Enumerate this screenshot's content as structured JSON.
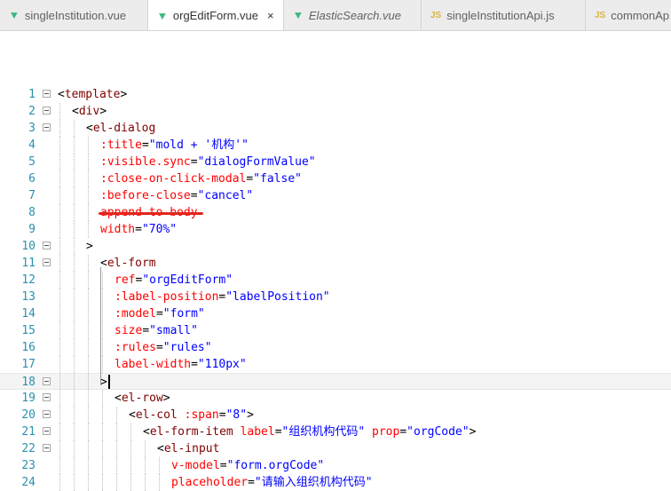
{
  "tabs": [
    {
      "label": "singleInstitution.vue",
      "icon": "vue-icon",
      "type": "vue",
      "active": false,
      "italic": false
    },
    {
      "label": "orgEditForm.vue",
      "icon": "vue-icon",
      "type": "vue",
      "active": true,
      "italic": false
    },
    {
      "label": "ElasticSearch.vue",
      "icon": "vue-icon",
      "type": "vue",
      "active": false,
      "italic": true
    },
    {
      "label": "singleInstitutionApi.js",
      "icon": "js-icon",
      "type": "js",
      "active": false,
      "italic": false
    },
    {
      "label": "commonAp",
      "icon": "js-icon",
      "type": "js",
      "active": false,
      "italic": false
    }
  ],
  "close_glyph": "×",
  "editor": {
    "current_line": 18,
    "strikethrough_line": 8,
    "lines": [
      {
        "n": "1",
        "indent": 0,
        "fold": true,
        "tokens": [
          [
            "t-punc",
            "<"
          ],
          [
            "t-tag",
            "template"
          ],
          [
            "t-punc",
            ">"
          ]
        ]
      },
      {
        "n": "2",
        "indent": 1,
        "fold": true,
        "tokens": [
          [
            "t-punc",
            "<"
          ],
          [
            "t-tag",
            "div"
          ],
          [
            "t-punc",
            ">"
          ]
        ]
      },
      {
        "n": "3",
        "indent": 2,
        "fold": true,
        "tokens": [
          [
            "t-punc",
            "<"
          ],
          [
            "t-tag",
            "el-dialog"
          ]
        ]
      },
      {
        "n": "4",
        "indent": 3,
        "fold": false,
        "tokens": [
          [
            "t-attr",
            ":title"
          ],
          [
            "t-punc",
            "="
          ],
          [
            "t-str",
            "\"mold + '机构'\""
          ]
        ]
      },
      {
        "n": "5",
        "indent": 3,
        "fold": false,
        "tokens": [
          [
            "t-attr",
            ":visible.sync"
          ],
          [
            "t-punc",
            "="
          ],
          [
            "t-str",
            "\"dialogFormValue\""
          ]
        ]
      },
      {
        "n": "6",
        "indent": 3,
        "fold": false,
        "tokens": [
          [
            "t-attr",
            ":close-on-click-modal"
          ],
          [
            "t-punc",
            "="
          ],
          [
            "t-str",
            "\"false\""
          ]
        ]
      },
      {
        "n": "7",
        "indent": 3,
        "fold": false,
        "tokens": [
          [
            "t-attr",
            ":before-close"
          ],
          [
            "t-punc",
            "="
          ],
          [
            "t-str",
            "\"cancel\""
          ]
        ]
      },
      {
        "n": "8",
        "indent": 3,
        "fold": false,
        "tokens": [
          [
            "t-attr",
            "append-to-body"
          ]
        ]
      },
      {
        "n": "9",
        "indent": 3,
        "fold": false,
        "tokens": [
          [
            "t-attr",
            "width"
          ],
          [
            "t-punc",
            "="
          ],
          [
            "t-str",
            "\"70%\""
          ]
        ]
      },
      {
        "n": "10",
        "indent": 2,
        "fold": true,
        "tokens": [
          [
            "t-punc",
            ">"
          ]
        ]
      },
      {
        "n": "11",
        "indent": 3,
        "fold": true,
        "tokens": [
          [
            "t-punc",
            "<"
          ],
          [
            "t-tag",
            "el-form"
          ]
        ]
      },
      {
        "n": "12",
        "indent": 4,
        "fold": false,
        "tokens": [
          [
            "t-attr",
            "ref"
          ],
          [
            "t-punc",
            "="
          ],
          [
            "t-str",
            "\"orgEditForm\""
          ]
        ]
      },
      {
        "n": "13",
        "indent": 4,
        "fold": false,
        "tokens": [
          [
            "t-attr",
            ":label-position"
          ],
          [
            "t-punc",
            "="
          ],
          [
            "t-str",
            "\"labelPosition\""
          ]
        ]
      },
      {
        "n": "14",
        "indent": 4,
        "fold": false,
        "tokens": [
          [
            "t-attr",
            ":model"
          ],
          [
            "t-punc",
            "="
          ],
          [
            "t-str",
            "\"form\""
          ]
        ]
      },
      {
        "n": "15",
        "indent": 4,
        "fold": false,
        "tokens": [
          [
            "t-attr",
            "size"
          ],
          [
            "t-punc",
            "="
          ],
          [
            "t-str",
            "\"small\""
          ]
        ]
      },
      {
        "n": "16",
        "indent": 4,
        "fold": false,
        "tokens": [
          [
            "t-attr",
            ":rules"
          ],
          [
            "t-punc",
            "="
          ],
          [
            "t-str",
            "\"rules\""
          ]
        ]
      },
      {
        "n": "17",
        "indent": 4,
        "fold": false,
        "tokens": [
          [
            "t-attr",
            "label-width"
          ],
          [
            "t-punc",
            "="
          ],
          [
            "t-str",
            "\"110px\""
          ]
        ]
      },
      {
        "n": "18",
        "indent": 3,
        "fold": true,
        "tokens": [
          [
            "t-punc",
            ">"
          ]
        ]
      },
      {
        "n": "19",
        "indent": 4,
        "fold": true,
        "tokens": [
          [
            "t-punc",
            "<"
          ],
          [
            "t-tag",
            "el-row"
          ],
          [
            "t-punc",
            ">"
          ]
        ]
      },
      {
        "n": "20",
        "indent": 5,
        "fold": true,
        "tokens": [
          [
            "t-punc",
            "<"
          ],
          [
            "t-tag",
            "el-col"
          ],
          [
            "t-punc",
            " "
          ],
          [
            "t-attr",
            ":span"
          ],
          [
            "t-punc",
            "="
          ],
          [
            "t-str",
            "\"8\""
          ],
          [
            "t-punc",
            ">"
          ]
        ]
      },
      {
        "n": "21",
        "indent": 6,
        "fold": true,
        "tokens": [
          [
            "t-punc",
            "<"
          ],
          [
            "t-tag",
            "el-form-item"
          ],
          [
            "t-punc",
            " "
          ],
          [
            "t-attr",
            "label"
          ],
          [
            "t-punc",
            "="
          ],
          [
            "t-str",
            "\"组织机构代码\""
          ],
          [
            "t-punc",
            " "
          ],
          [
            "t-attr",
            "prop"
          ],
          [
            "t-punc",
            "="
          ],
          [
            "t-str",
            "\"orgCode\""
          ],
          [
            "t-punc",
            ">"
          ]
        ]
      },
      {
        "n": "22",
        "indent": 7,
        "fold": true,
        "tokens": [
          [
            "t-punc",
            "<"
          ],
          [
            "t-tag",
            "el-input"
          ]
        ]
      },
      {
        "n": "23",
        "indent": 8,
        "fold": false,
        "tokens": [
          [
            "t-attr",
            "v-model"
          ],
          [
            "t-punc",
            "="
          ],
          [
            "t-str",
            "\"form.orgCode\""
          ]
        ]
      },
      {
        "n": "24",
        "indent": 8,
        "fold": false,
        "tokens": [
          [
            "t-attr",
            "placeholder"
          ],
          [
            "t-punc",
            "="
          ],
          [
            "t-str",
            "\"请输入组织机构代码\""
          ]
        ]
      }
    ]
  }
}
